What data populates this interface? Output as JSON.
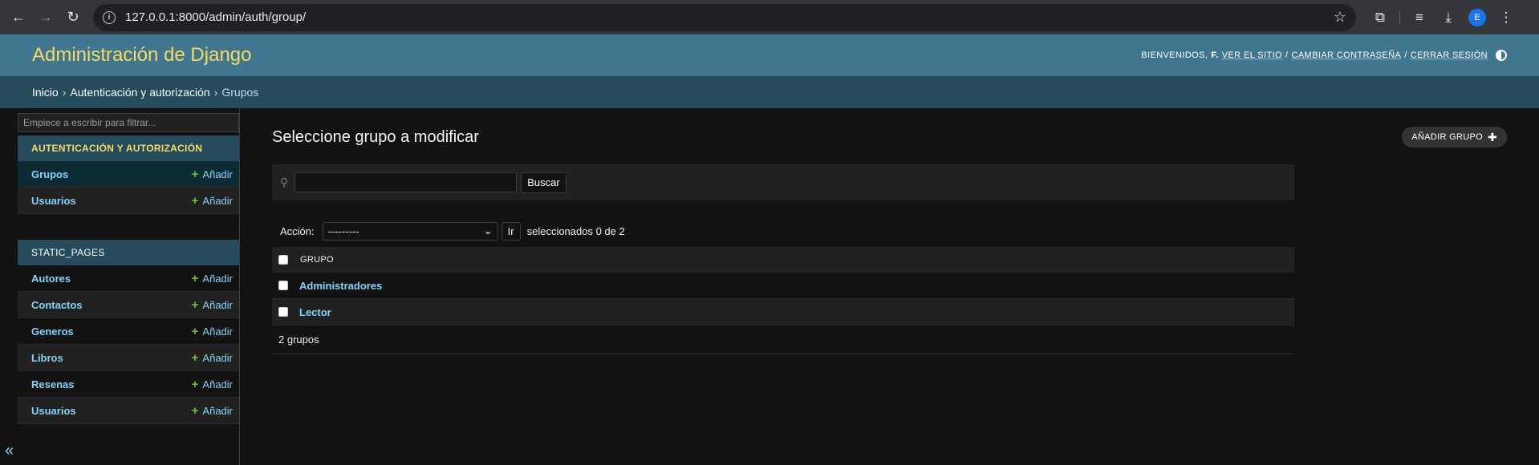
{
  "browser": {
    "url": "127.0.0.1:8000/admin/auth/group/",
    "profile_initial": "E"
  },
  "header": {
    "branding": "Administración de Django",
    "welcome": "BIENVENIDOS,",
    "user": "F.",
    "view_site": "VER EL SITIO",
    "change_password": "CAMBIAR CONTRASEÑA",
    "logout": "CERRAR SESIÓN"
  },
  "breadcrumbs": {
    "home": "Inicio",
    "app": "Autenticación y autorización",
    "current": "Grupos"
  },
  "sidebar": {
    "filter_placeholder": "Empiece a escribir para filtrar...",
    "apps": [
      {
        "caption": "AUTENTICACIÓN Y AUTORIZACIÓN",
        "models": [
          {
            "name": "Grupos",
            "add": "Añadir"
          },
          {
            "name": "Usuarios",
            "add": "Añadir"
          }
        ]
      },
      {
        "caption": "STATIC_PAGES",
        "models": [
          {
            "name": "Autores",
            "add": "Añadir"
          },
          {
            "name": "Contactos",
            "add": "Añadir"
          },
          {
            "name": "Generos",
            "add": "Añadir"
          },
          {
            "name": "Libros",
            "add": "Añadir"
          },
          {
            "name": "Resenas",
            "add": "Añadir"
          },
          {
            "name": "Usuarios",
            "add": "Añadir"
          }
        ]
      }
    ],
    "collapse": "«"
  },
  "content": {
    "title": "Seleccione grupo a modificar",
    "add_button": "AÑADIR GRUPO",
    "search_button": "Buscar",
    "action_label": "Acción:",
    "action_selected": "---------",
    "go_button": "Ir",
    "counter": "seleccionados 0 de 2",
    "column_header": "GRUPO",
    "rows": [
      "Administradores",
      "Lector"
    ],
    "paginator": "2 grupos"
  }
}
